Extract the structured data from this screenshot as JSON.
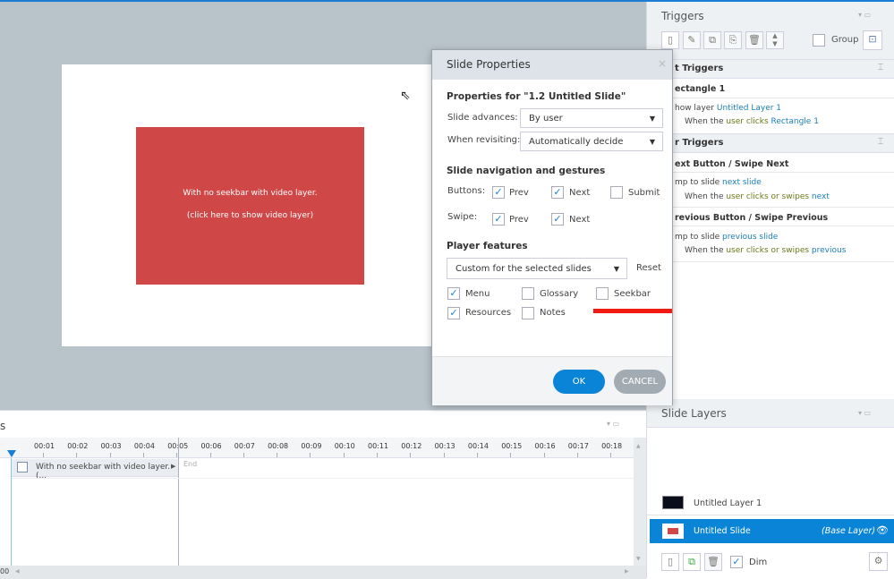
{
  "slide": {
    "line1": "With no seekbar with video layer.",
    "line2": "(click here to show video layer)"
  },
  "dialog": {
    "title": "Slide Properties",
    "close": "×",
    "properties_for": "Properties for \"1.2 Untitled Slide\"",
    "slide_advances_label": "Slide advances:",
    "slide_advances_value": "By user",
    "when_revisiting_label": "When revisiting:",
    "when_revisiting_value": "Automatically decide",
    "nav_heading": "Slide navigation and gestures",
    "buttons_label": "Buttons:",
    "swipe_label": "Swipe:",
    "prev": "Prev",
    "next": "Next",
    "submit": "Submit",
    "player_heading": "Player features",
    "player_value": "Custom for the selected slides",
    "reset": "Reset",
    "menu": "Menu",
    "glossary": "Glossary",
    "seekbar": "Seekbar",
    "resources": "Resources",
    "notes": "Notes",
    "ok": "OK",
    "cancel": "CANCEL",
    "checks": {
      "btn_prev": true,
      "btn_next": true,
      "btn_submit": false,
      "swipe_prev": true,
      "swipe_next": true,
      "menu": true,
      "glossary": false,
      "seekbar": false,
      "resources": true,
      "notes": false
    }
  },
  "triggers": {
    "title": "Triggers",
    "group": "Group",
    "sec1": "t Triggers",
    "obj1": "ectangle 1",
    "t1_action": "how layer ",
    "t1_target": "Untitled Layer 1",
    "t1_when": "When the ",
    "t1_user": "user clicks ",
    "t1_obj": "Rectangle 1",
    "sec2": "r Triggers",
    "obj2": "ext Button / Swipe Next",
    "t2_action": "mp to slide ",
    "t2_target": "next slide",
    "t2_when": "When the ",
    "t2_user": "user clicks or swipes ",
    "t2_obj": "next",
    "obj3": "revious Button / Swipe Previous",
    "t3_action": "mp to slide ",
    "t3_target": "previous slide",
    "t3_when": "When the ",
    "t3_user": "user clicks or swipes ",
    "t3_obj": "previous"
  },
  "layers": {
    "title": "Slide Layers",
    "items": [
      {
        "name": "Untitled Layer 1"
      },
      {
        "name": "Untitled Slide",
        "tag": "(Base Layer)"
      }
    ],
    "dim": "Dim"
  },
  "timeline": {
    "title_fragment": "s",
    "ticks": [
      "00:01",
      "00:02",
      "00:03",
      "00:04",
      "00:05",
      "00:06",
      "00:07",
      "00:08",
      "00:09",
      "00:10",
      "00:11",
      "00:12",
      "00:13",
      "00:14",
      "00:15",
      "00:16",
      "00:17",
      "00:18"
    ],
    "row_label": "With no seekbar with video layer. (...",
    "end": "End",
    "time_fragment": "00"
  },
  "colors": {
    "accent": "#1a7fd4",
    "slide_rect": "#d04747",
    "highlight": "#f01a10"
  }
}
